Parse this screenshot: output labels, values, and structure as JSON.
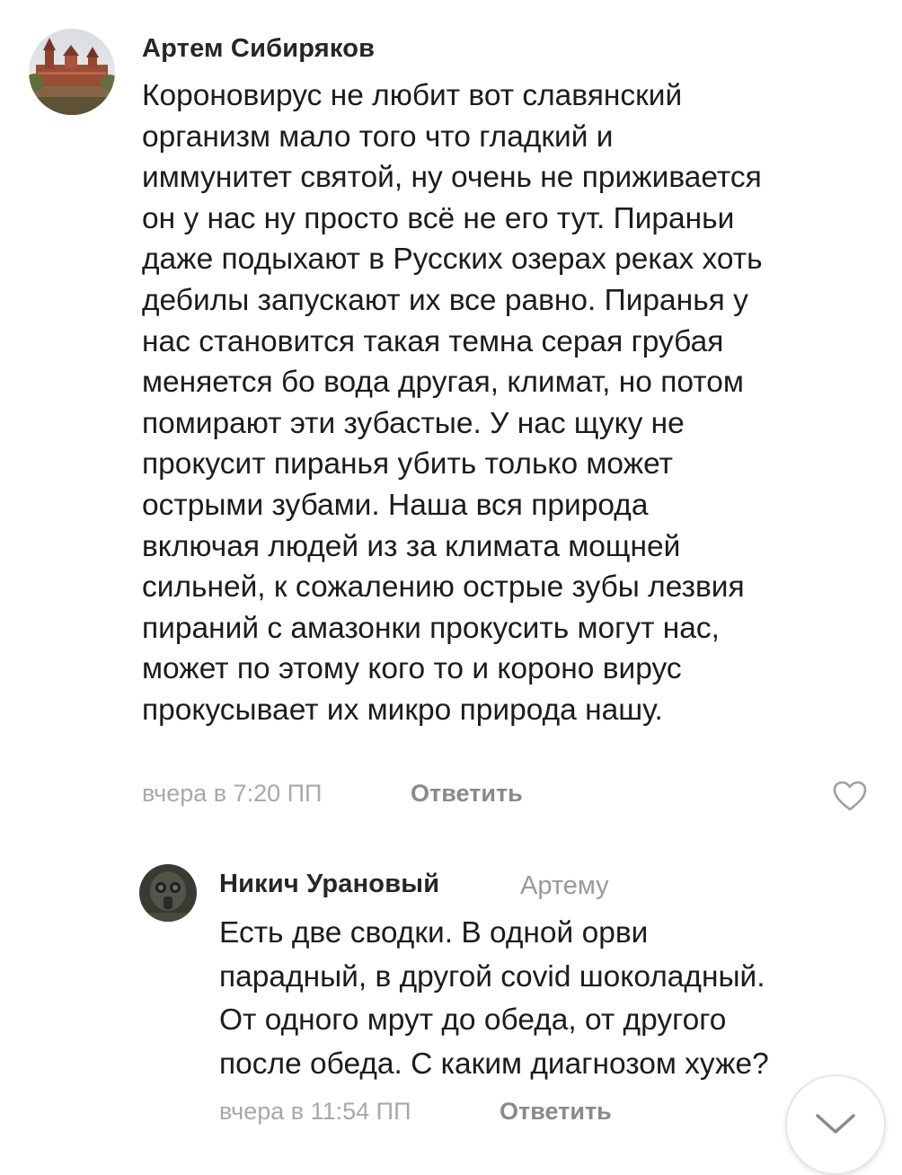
{
  "comments": [
    {
      "author": "Артем Сибиряков",
      "avatar_icon": "castle-photo-avatar",
      "text": "Короновирус не любит вот славянский\nорганизм мало того что гладкий и\nиммунитет святой, ну очень не приживается\nон у нас ну просто всё не его тут. Пираньи\nдаже подыхают в Русских озерах реках хоть\nдебилы запускают их все равно. Пиранья у\nнас становится такая темна серая грубая\nменяется бо вода другая, климат, но потом\nпомирают эти зубастые. У нас щуку не\nпрокусит пиранья убить только может\nострыми зубами. Наша вся природа\nвключая людей из за климата мощней\nсильней, к сожалению острые зубы лезвия\nпираний с амазонки прокусить могут нас,\nможет по этому кого то и короно вирус\nпрокусывает их микро природа нашу.",
      "timestamp": "вчера в 7:20 ПП",
      "reply_label": "Ответить",
      "like_icon": "heart-icon"
    },
    {
      "author": "Никич Урановый",
      "reply_to": "Артему",
      "avatar_icon": "gas-mask-avatar",
      "text": "Есть две сводки. В одной орви\nпарадный, в другой covid шоколадный.\nОт одного мрут до обеда, от другого\nпосле обеда. С каким диагнозом хуже?",
      "timestamp": "вчера в 11:54 ПП",
      "reply_label": "Ответить"
    }
  ],
  "scroll_down_icon": "chevron-down-icon",
  "colors": {
    "text": "#1c1c1c",
    "author": "#262626",
    "muted": "#a8a8a8",
    "reply_link": "#8a8a8a"
  }
}
